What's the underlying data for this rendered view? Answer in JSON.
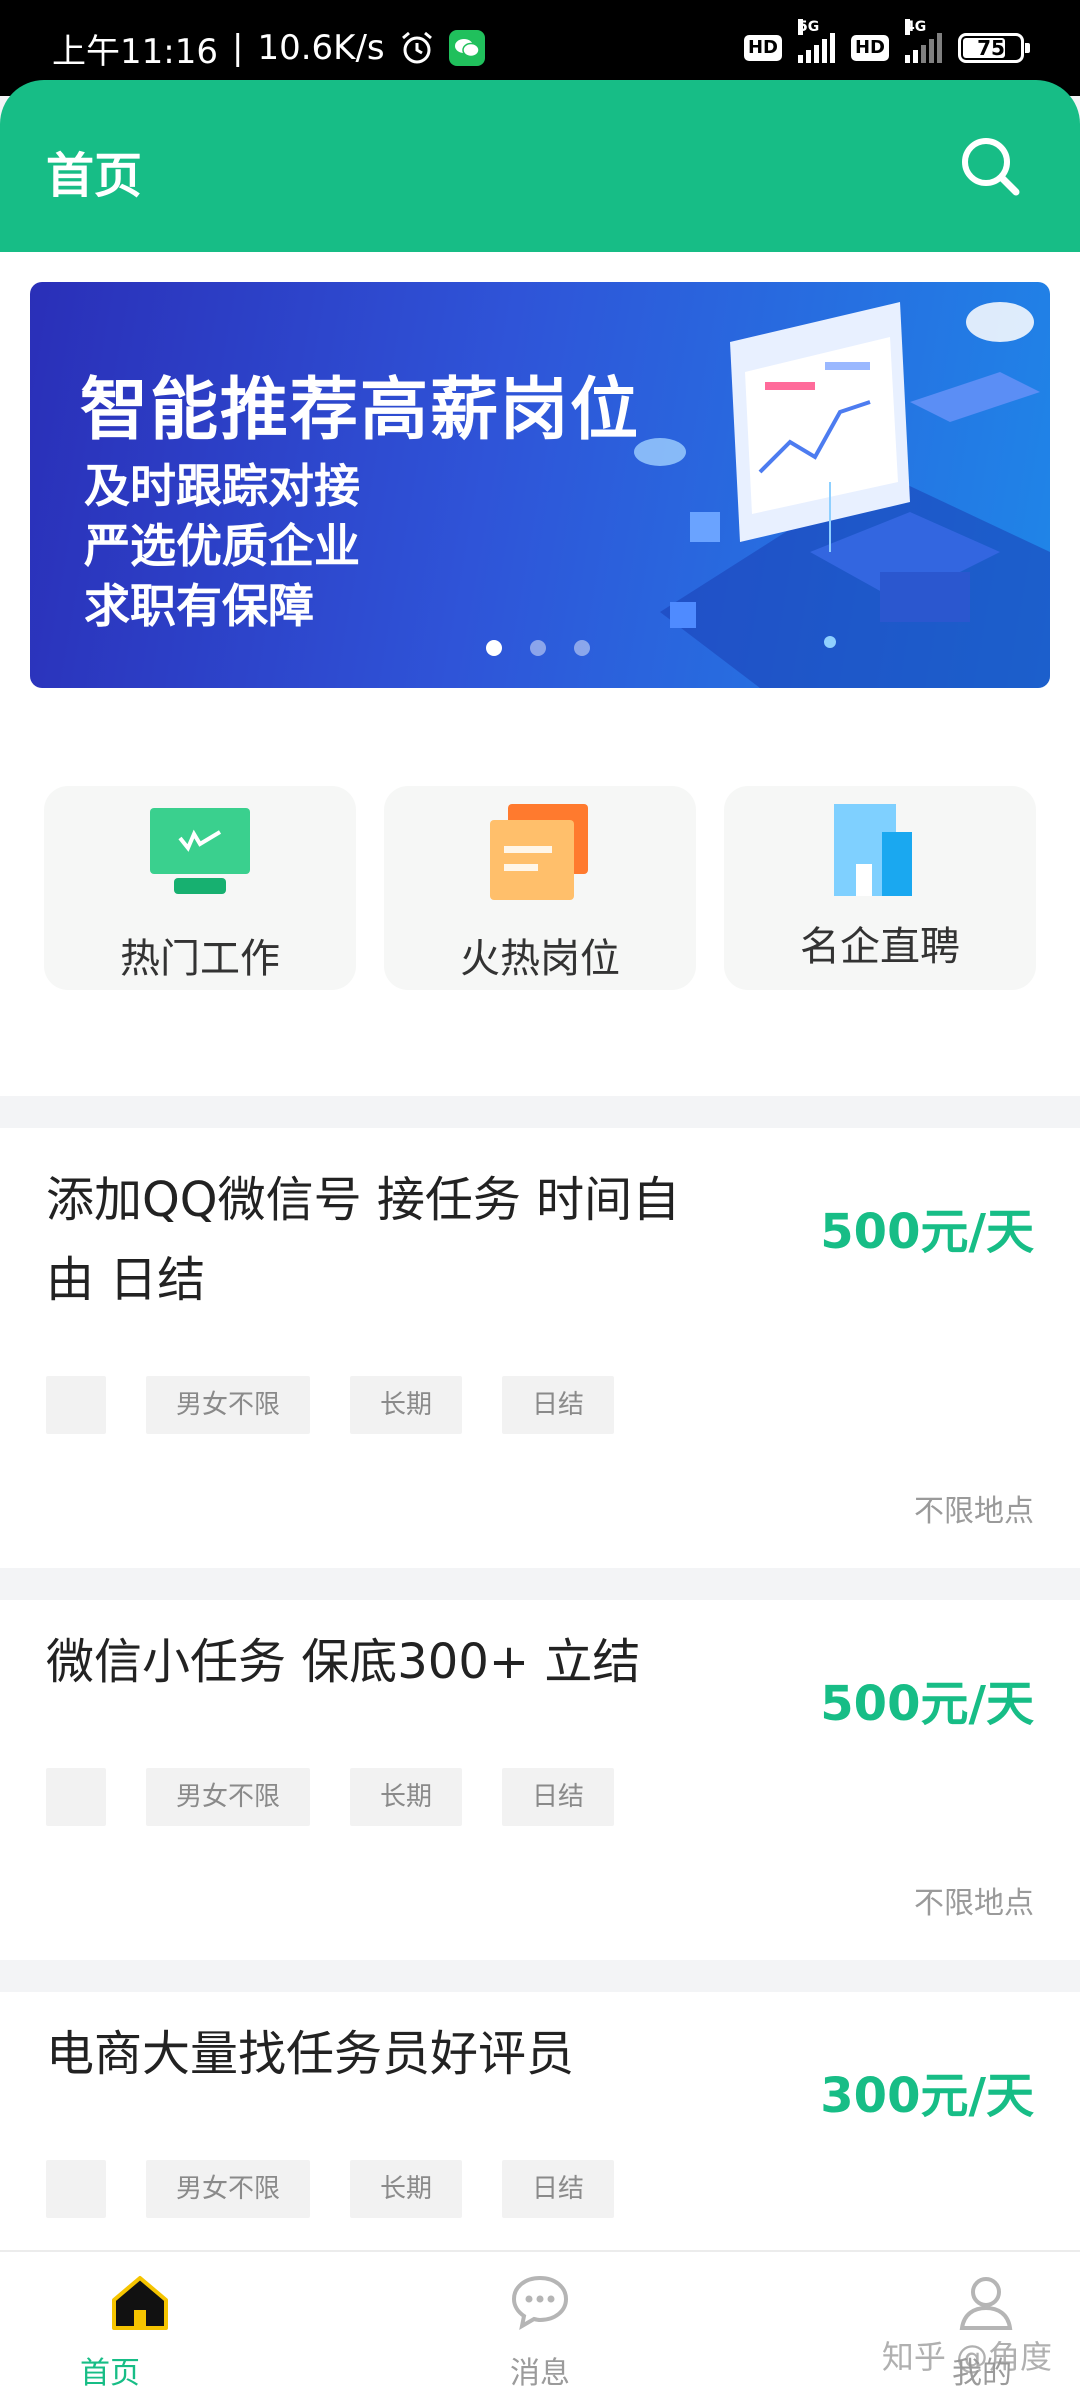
{
  "status_bar": {
    "time": "上午11:16",
    "separator": "|",
    "net_speed": "10.6K/s",
    "alarm_icon": "alarm-icon",
    "wechat_icon": "wechat-icon",
    "hd1": "HD",
    "net1": "5G",
    "hd2": "HD",
    "net2": "4G",
    "battery": "75"
  },
  "header": {
    "title": "首页",
    "search_icon": "search-icon"
  },
  "banner": {
    "headline": "智能推荐高薪岗位",
    "lines": [
      "及时跟踪对接",
      "严选优质企业",
      "求职有保障"
    ],
    "active_dot": 1,
    "dot_count": 3
  },
  "categories": [
    {
      "label": "热门工作",
      "icon": "monitor-icon"
    },
    {
      "label": "火热岗位",
      "icon": "folder-icon"
    },
    {
      "label": "名企直聘",
      "icon": "building-icon"
    }
  ],
  "jobs": [
    {
      "title_line1": "添加QQ微信号  接任务  时间自",
      "title_line2": "由  日结",
      "pay": "500元/天",
      "tags": [
        "",
        "男女不限",
        "长期",
        "日结"
      ],
      "location": "不限地点"
    },
    {
      "title_line1": "微信小任务   保底300+   立结",
      "title_line2": "",
      "pay": "500元/天",
      "tags": [
        "",
        "男女不限",
        "长期",
        "日结"
      ],
      "location": "不限地点"
    },
    {
      "title_line1": "电商大量找任务员好评员",
      "title_line2": "",
      "pay": "300元/天",
      "tags": [
        "",
        "男女不限",
        "长期",
        "日结"
      ],
      "location": ""
    }
  ],
  "tabbar": [
    {
      "label": "首页",
      "icon": "home-icon",
      "active": true
    },
    {
      "label": "消息",
      "icon": "chat-icon",
      "active": false
    },
    {
      "label": "我的",
      "icon": "user-icon",
      "active": false
    }
  ],
  "watermark": "知乎 @角度",
  "colors": {
    "primary": "#17bd86",
    "status_bar": "#000000",
    "banner_start": "#2a2fb8",
    "banner_end": "#1f86e8",
    "tag_bg": "#f2f2f2",
    "page_bg": "#f3f4f6"
  }
}
